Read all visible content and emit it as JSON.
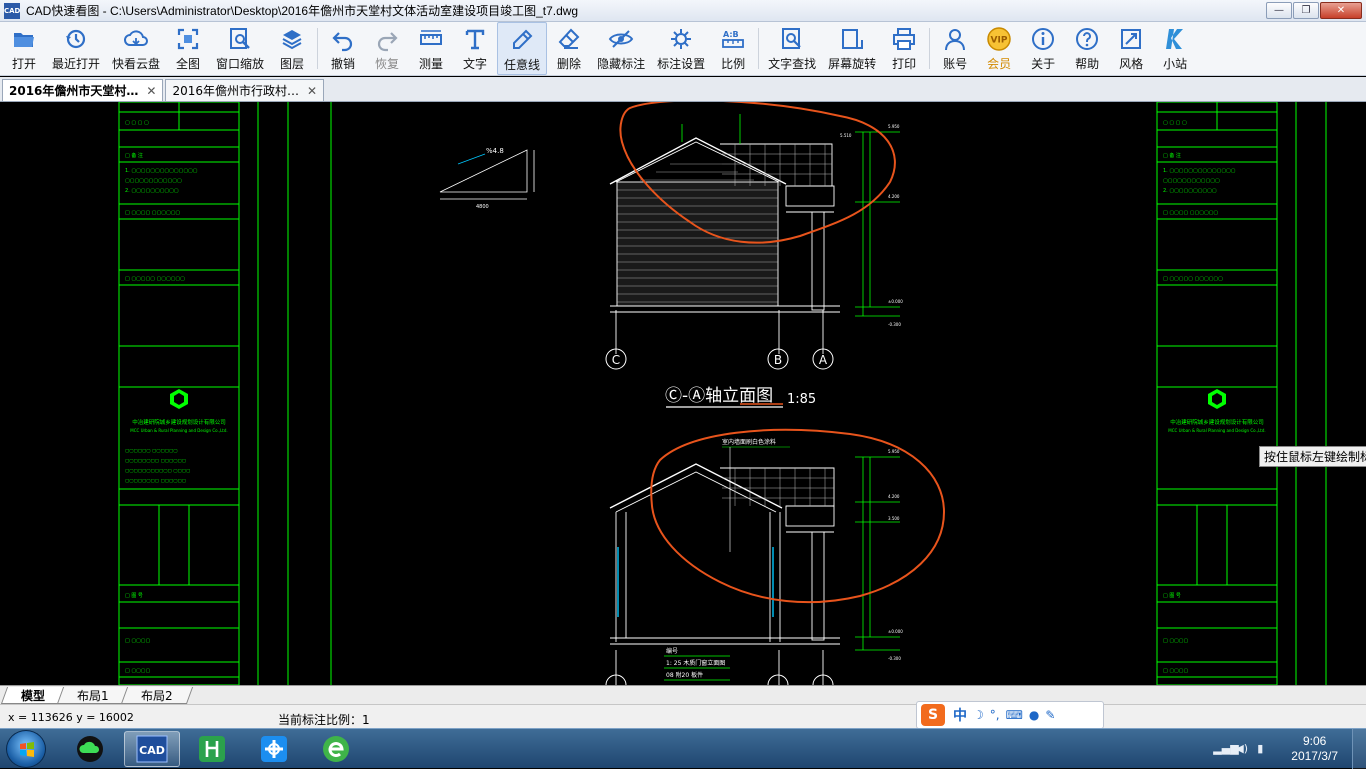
{
  "window": {
    "app_icon_text": "CAD",
    "title": "CAD快速看图 - C:\\Users\\Administrator\\Desktop\\2016年儋州市天堂村文体活动室建设项目竣工图_t7.dwg"
  },
  "toolbar": {
    "items": [
      {
        "label": "打开",
        "icon": "folder-open-icon"
      },
      {
        "label": "最近打开",
        "icon": "recent-clock-icon"
      },
      {
        "label": "快看云盘",
        "icon": "cloud-icon"
      },
      {
        "label": "全图",
        "icon": "fullview-icon"
      },
      {
        "label": "窗口缩放",
        "icon": "window-zoom-icon"
      },
      {
        "label": "图层",
        "icon": "layers-icon"
      },
      {
        "label": "撤销",
        "icon": "undo-icon"
      },
      {
        "label": "恢复",
        "icon": "redo-icon"
      },
      {
        "label": "测量",
        "icon": "ruler-icon"
      },
      {
        "label": "文字",
        "icon": "text-icon"
      },
      {
        "label": "任意线",
        "icon": "pencil-icon"
      },
      {
        "label": "删除",
        "icon": "eraser-icon"
      },
      {
        "label": "隐藏标注",
        "icon": "eye-hide-icon"
      },
      {
        "label": "标注设置",
        "icon": "annotation-settings-icon"
      },
      {
        "label": "比例",
        "icon": "scale-icon"
      },
      {
        "label": "文字查找",
        "icon": "text-search-icon"
      },
      {
        "label": "屏幕旋转",
        "icon": "screen-rotate-icon"
      },
      {
        "label": "打印",
        "icon": "printer-icon"
      },
      {
        "label": "账号",
        "icon": "user-icon"
      },
      {
        "label": "会员",
        "icon": "vip-icon",
        "badge": "VIP"
      },
      {
        "label": "关于",
        "icon": "info-icon"
      },
      {
        "label": "帮助",
        "icon": "help-icon"
      },
      {
        "label": "风格",
        "icon": "style-icon"
      },
      {
        "label": "小站",
        "icon": "k-station-icon"
      }
    ]
  },
  "tabs": [
    {
      "label": "2016年儋州市天堂村…",
      "active": true
    },
    {
      "label": "2016年儋州市行政村…",
      "active": false
    }
  ],
  "drawing": {
    "view1_title": "Ⓒ-Ⓐ轴立面图",
    "view1_scale": "1:85",
    "axis_c": "C",
    "axis_b": "B",
    "axis_a": "A",
    "slope_label": "%4.8",
    "slope_dim": "4800",
    "wall_note": "室内墙面刷白色涂料",
    "table_row1": "1: 25  木质门窗立面图",
    "table_row2": "08  附20  板件",
    "table_header": "编号",
    "side_note_1": "中华人民共和国住房和城乡建设部",
    "company_name": "中冶建研院城乡建设规划设计有限公司",
    "company_en": "MCC Urban & Rural Planning and Design Co.,Ltd.",
    "sheet_no": "Sheet No."
  },
  "canvas": {
    "tooltip": "按住鼠标左键绘制标"
  },
  "layout_tabs": [
    "模型",
    "布局1",
    "布局2"
  ],
  "status": {
    "coords": "x = 113626  y = 16002",
    "scale": "当前标注比例：1"
  },
  "ime": {
    "logo": "S",
    "lang": "中",
    "moon": "☽",
    "punct": "°,"
  },
  "taskbar": {
    "time": "9:06",
    "date": "2017/3/7"
  },
  "colors": {
    "cad_green": "#00ff00",
    "cad_white": "#ffffff",
    "markup_orange": "#e8541c",
    "cad_cyan": "#00c8ff"
  }
}
